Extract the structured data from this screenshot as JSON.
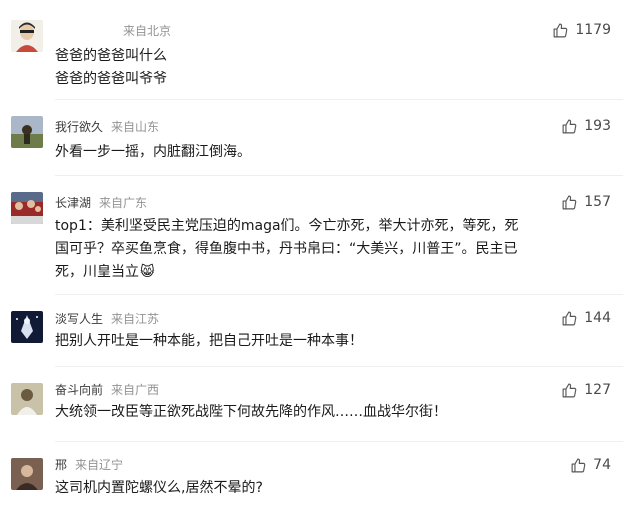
{
  "comments": [
    {
      "username": "",
      "location": "来自北京",
      "likes": "1179",
      "lines": [
        "爸爸的爸爸叫什么",
        "爸爸的爸爸叫爷爷"
      ],
      "avatar_color": "#e8e2d8"
    },
    {
      "username": "我行欲久",
      "location": "来自山东",
      "likes": "193",
      "lines": [
        "外看一步一摇，内脏翻江倒海。"
      ],
      "avatar_color": "#6b7a55"
    },
    {
      "username": "长津湖",
      "location": "来自广东",
      "likes": "157",
      "lines": [
        "top1：美利坚受民主党压迫的maga们。今亡亦死，举大计亦死，等死，死",
        "国可乎？卒买鱼烹食，得鱼腹中书，丹书帛曰：“大美兴，川普王”。民主已",
        "死，川皇当立"
      ],
      "emoji": "😸",
      "avatar_color": "#8a3a3a"
    },
    {
      "username": "淡写人生",
      "location": "来自江苏",
      "likes": "144",
      "lines": [
        "把别人开吐是一种本能，把自己开吐是一种本事！"
      ],
      "avatar_color": "#1f2a4a"
    },
    {
      "username": "奋斗向前",
      "location": "来自广西",
      "likes": "127",
      "lines": [
        "大统领一改臣等正欲死战陛下何故先降的作风……血战华尔街！"
      ],
      "avatar_color": "#9a8a6a"
    },
    {
      "username": "邢",
      "location": "来自辽宁",
      "likes": "74",
      "lines": [
        "这司机内置陀螺仪么,居然不晕的?"
      ],
      "avatar_color": "#5a4a40"
    }
  ],
  "icons": {
    "like": "thumbs-up-icon"
  },
  "colors": {
    "username": "#3a3a3a",
    "location": "#939393",
    "text": "#1a1a1a",
    "divider": "#efefef"
  }
}
